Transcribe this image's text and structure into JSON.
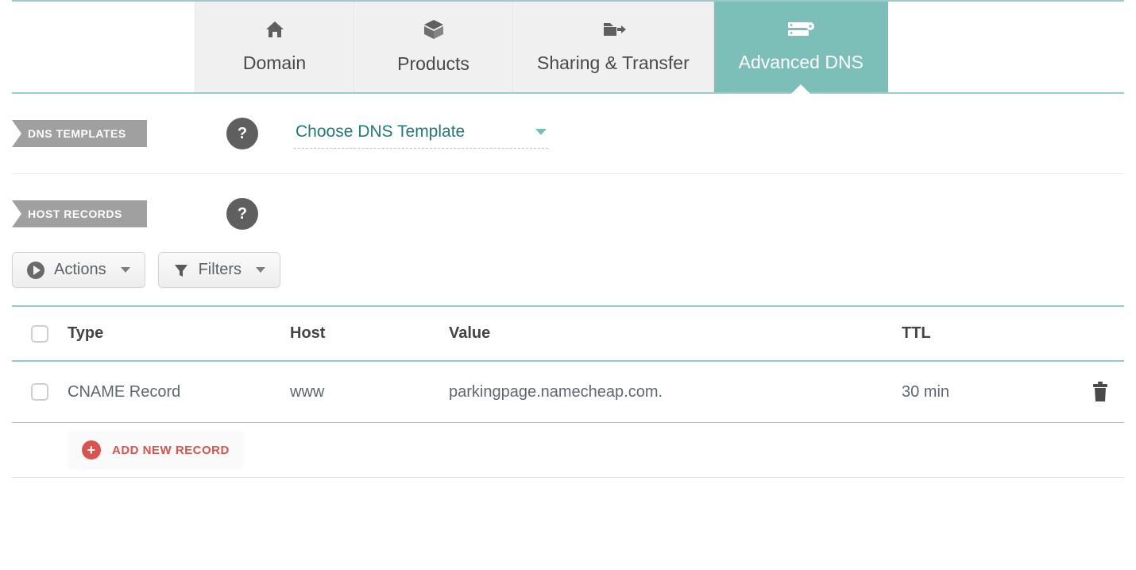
{
  "tabs": {
    "domain": "Domain",
    "products": "Products",
    "sharing": "Sharing & Transfer",
    "advanced": "Advanced DNS"
  },
  "sections": {
    "dns_templates": "DNS TEMPLATES",
    "host_records": "HOST RECORDS",
    "template_placeholder": "Choose DNS Template"
  },
  "toolbar": {
    "actions": "Actions",
    "filters": "Filters"
  },
  "table": {
    "headers": {
      "type": "Type",
      "host": "Host",
      "value": "Value",
      "ttl": "TTL"
    },
    "rows": [
      {
        "type": "CNAME Record",
        "host": "www",
        "value": "parkingpage.namecheap.com.",
        "ttl": "30 min"
      }
    ]
  },
  "add_record": "ADD NEW RECORD",
  "help_glyph": "?"
}
